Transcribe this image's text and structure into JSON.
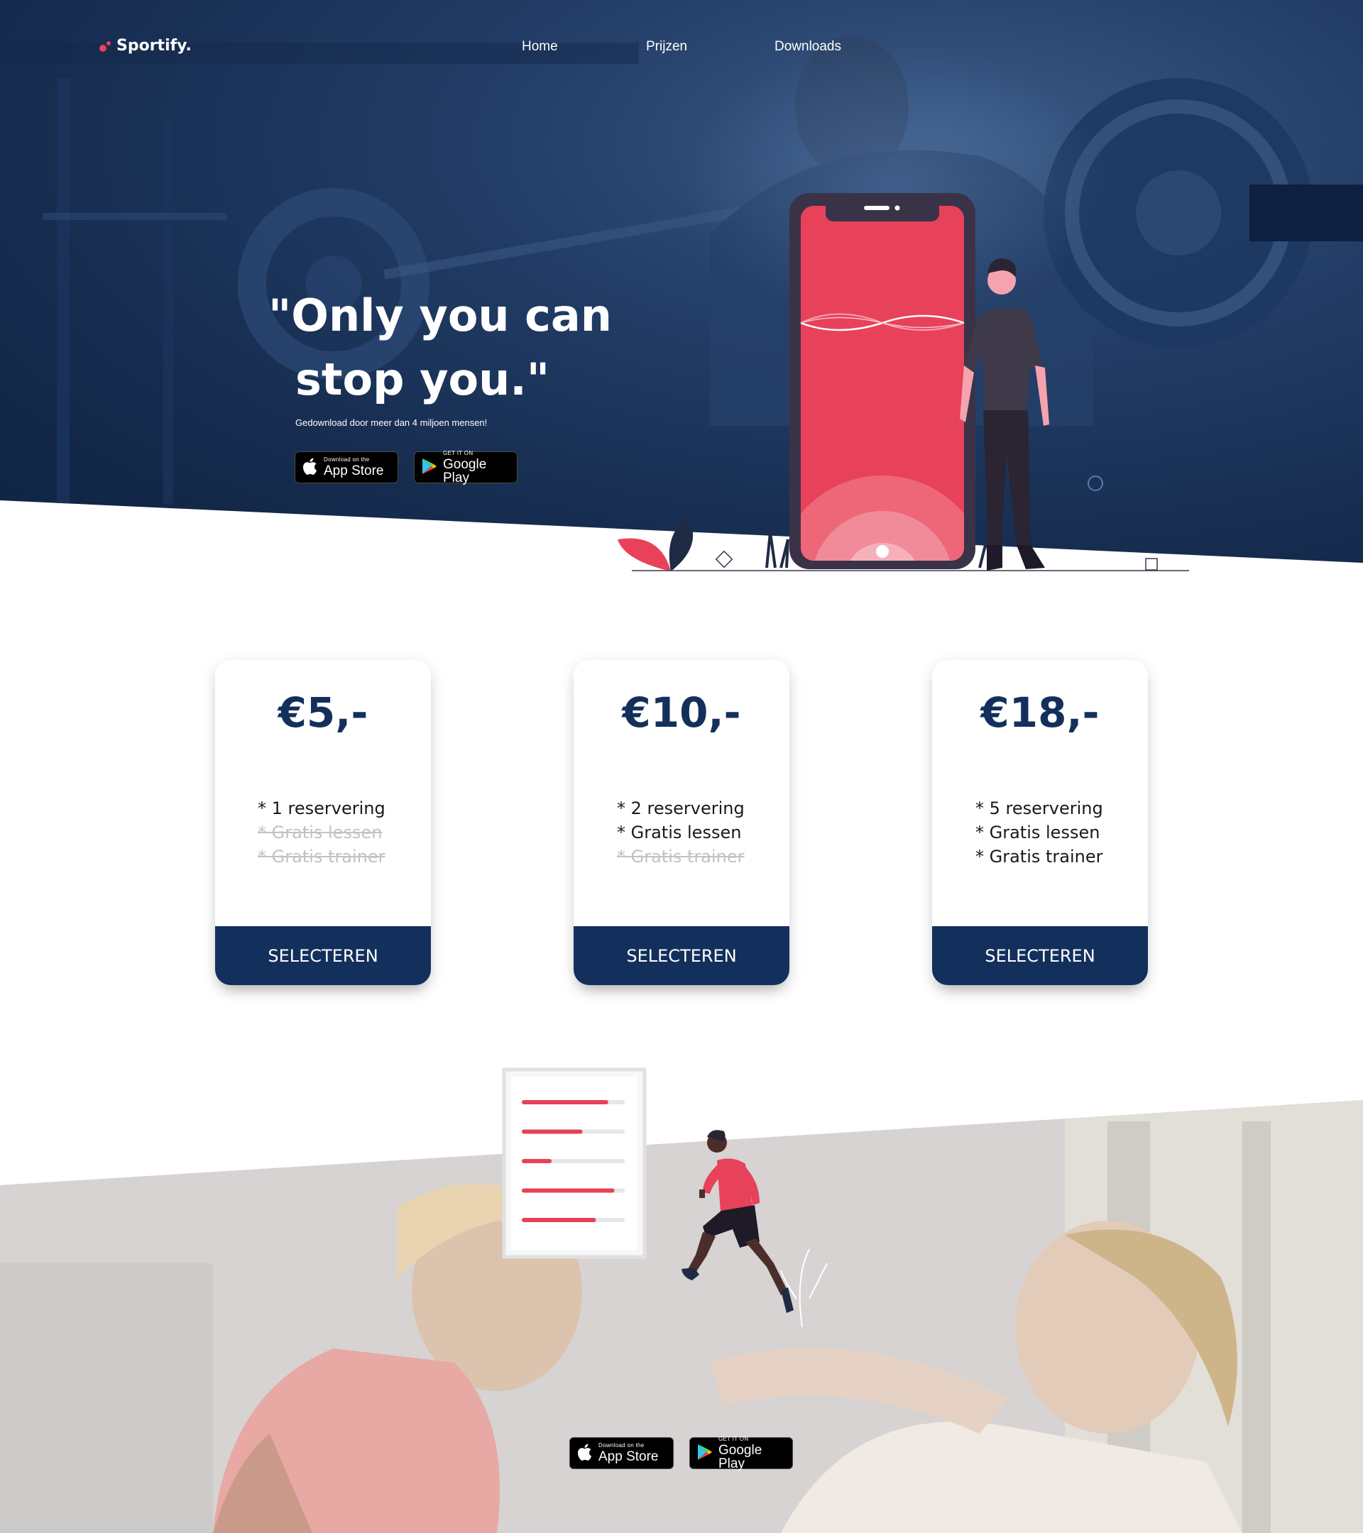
{
  "brand": {
    "name": "Sportify.",
    "accent": "#e8415a",
    "navy": "#13305c"
  },
  "nav": {
    "items": [
      "Home",
      "Prijzen",
      "Downloads"
    ]
  },
  "hero": {
    "title_line1": "\"Only you can",
    "title_line2": "stop you.\"",
    "subtitle": "Gedownload door meer dan 4 miljoen mensen!"
  },
  "stores": {
    "appstore_small": "Download on the",
    "appstore_big": "App Store",
    "googleplay_small": "GET IT ON",
    "googleplay_big": "Google Play"
  },
  "pricing": {
    "button_label": "SELECTEREN",
    "cards": [
      {
        "price": "€5,-",
        "features": [
          {
            "text": "* 1 reservering",
            "included": true
          },
          {
            "text": "* Gratis lessen",
            "included": false
          },
          {
            "text": "* Gratis trainer",
            "included": false
          }
        ]
      },
      {
        "price": "€10,-",
        "features": [
          {
            "text": "* 2 reservering",
            "included": true
          },
          {
            "text": "* Gratis lessen",
            "included": true
          },
          {
            "text": "* Gratis trainer",
            "included": false
          }
        ]
      },
      {
        "price": "€18,-",
        "features": [
          {
            "text": "* 5 reservering",
            "included": true
          },
          {
            "text": "* Gratis lessen",
            "included": true
          },
          {
            "text": "* Gratis trainer",
            "included": true
          }
        ]
      }
    ]
  },
  "progress_bars": [
    0.84,
    0.59,
    0.29,
    0.9,
    0.72
  ]
}
